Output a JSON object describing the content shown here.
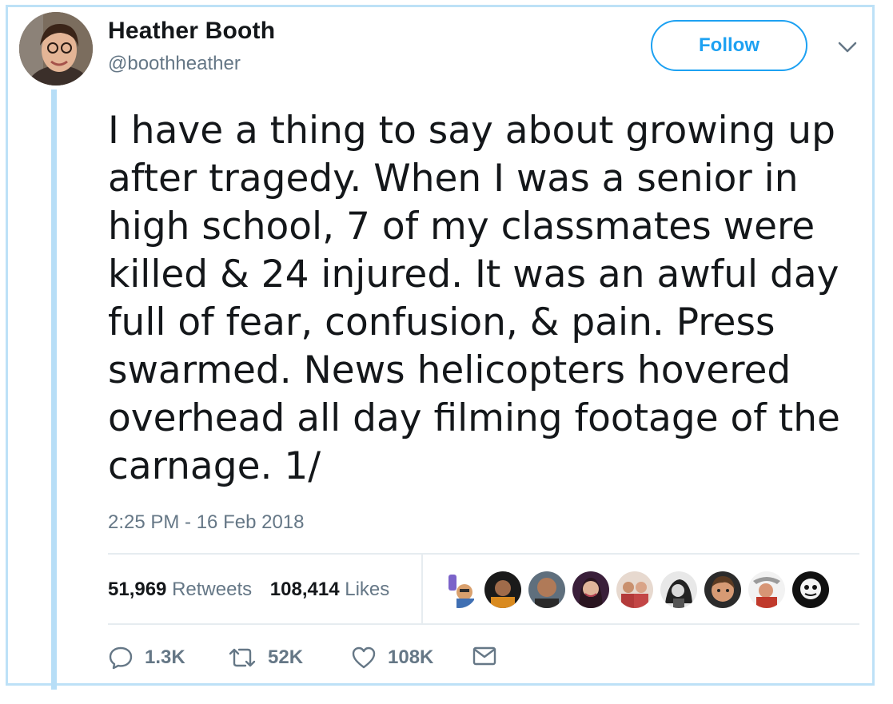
{
  "author": {
    "name": "Heather Booth",
    "handle": "@boothheather"
  },
  "follow_label": "Follow",
  "tweet": {
    "text": "I have a thing to say about growing up after tragedy. When I was a senior in high school, 7 of my classmates were killed & 24 injured. It was an awful day full of fear, confusion, & pain. Press swarmed. News helicopters hovered overhead all day filming footage of the carnage. 1/",
    "timestamp": "2:25 PM - 16 Feb 2018"
  },
  "stats": {
    "retweets_count": "51,969",
    "retweets_label": "Retweets",
    "likes_count": "108,414",
    "likes_label": "Likes"
  },
  "actions": {
    "replies": "1.3K",
    "retweets": "52K",
    "likes": "108K"
  },
  "colors": {
    "accent": "#1da1f2",
    "muted": "#657786",
    "thread": "#b7def7"
  },
  "icons": [
    "reply-icon",
    "retweet-icon",
    "heart-icon",
    "direct-message-icon",
    "chevron-down-icon"
  ]
}
